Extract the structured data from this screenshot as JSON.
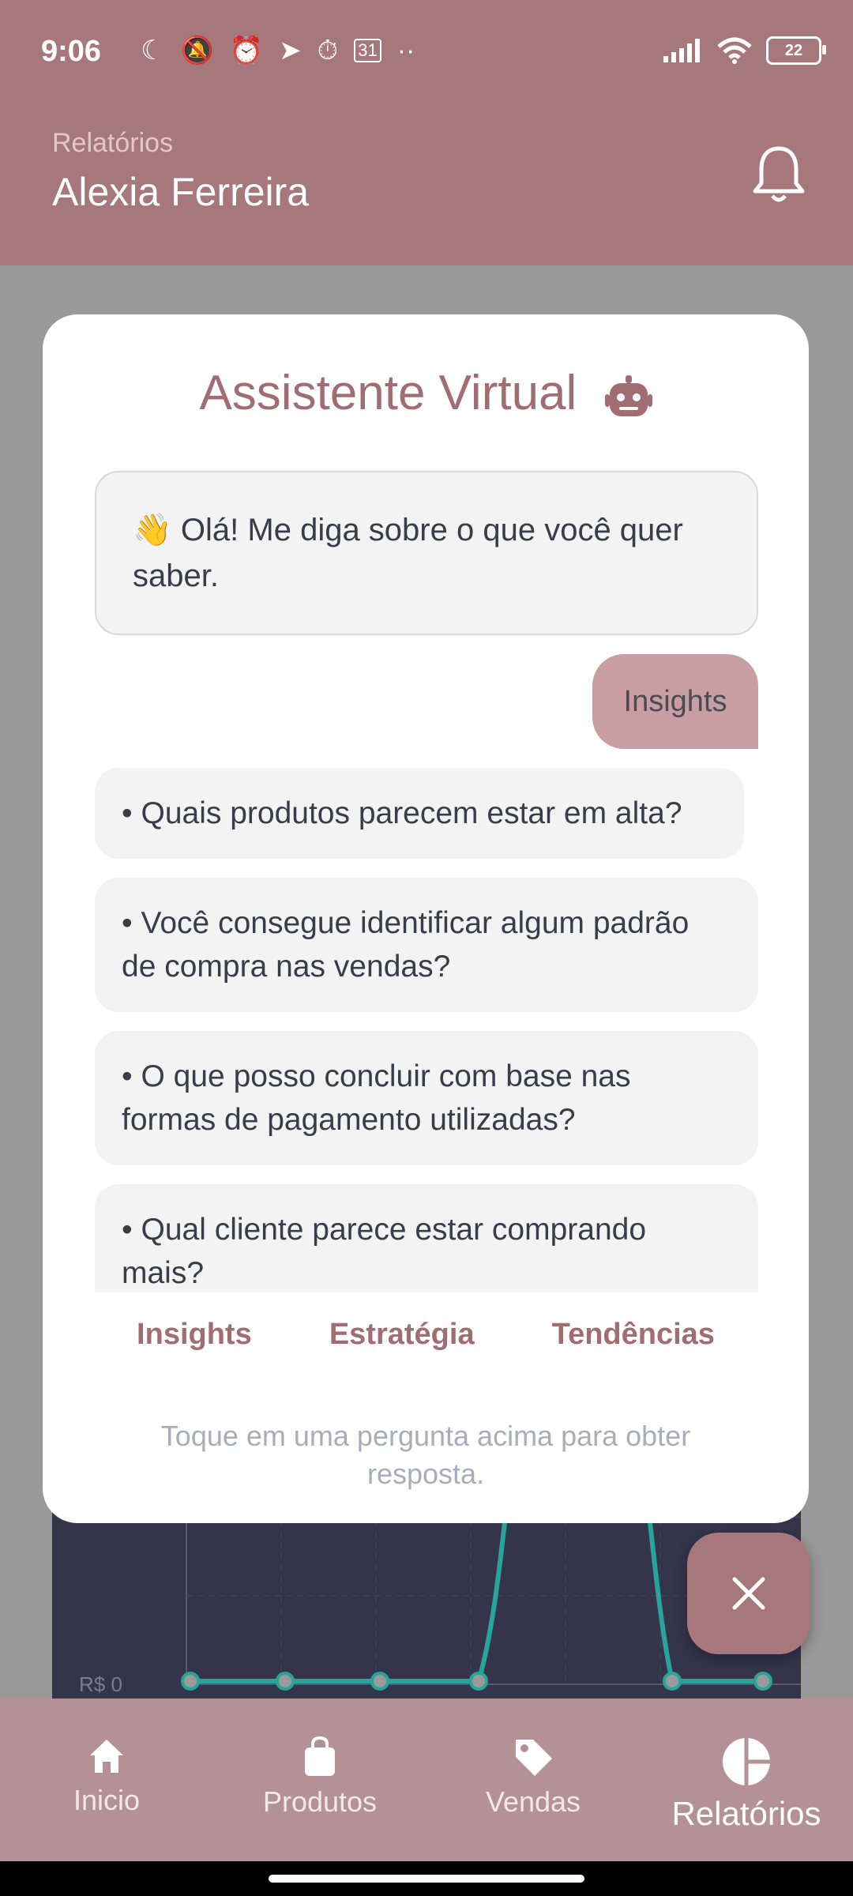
{
  "status_bar": {
    "time": "9:06",
    "calendar_day": "31",
    "battery": "22"
  },
  "header": {
    "subtitle": "Relatórios",
    "title": "Alexia Ferreira"
  },
  "chart_background": {
    "axis_label": "R$ 0"
  },
  "assistant": {
    "title": "Assistente Virtual",
    "greeting": "👋 Olá! Me diga sobre o que você quer saber.",
    "user_message": "Insights",
    "questions": [
      "• Quais produtos parecem estar em alta?",
      "• Você consegue identificar algum padrão de compra nas vendas?",
      "• O que posso concluir com base nas formas de pagamento utilizadas?",
      "• Qual cliente parece estar comprando mais?"
    ],
    "tabs": [
      "Insights",
      "Estratégia",
      "Tendências"
    ],
    "hint": "Toque em uma pergunta acima para obter resposta."
  },
  "bottom_nav": [
    {
      "label": "Inicio",
      "icon": "home-icon"
    },
    {
      "label": "Produtos",
      "icon": "shopping-bag-icon"
    },
    {
      "label": "Vendas",
      "icon": "tag-icon"
    },
    {
      "label": "Relatórios",
      "icon": "pie-chart-icon",
      "active": true
    }
  ],
  "colors": {
    "primary": "#a6777b",
    "accent_text": "#a16c72",
    "user_bubble": "#c99ea2"
  }
}
